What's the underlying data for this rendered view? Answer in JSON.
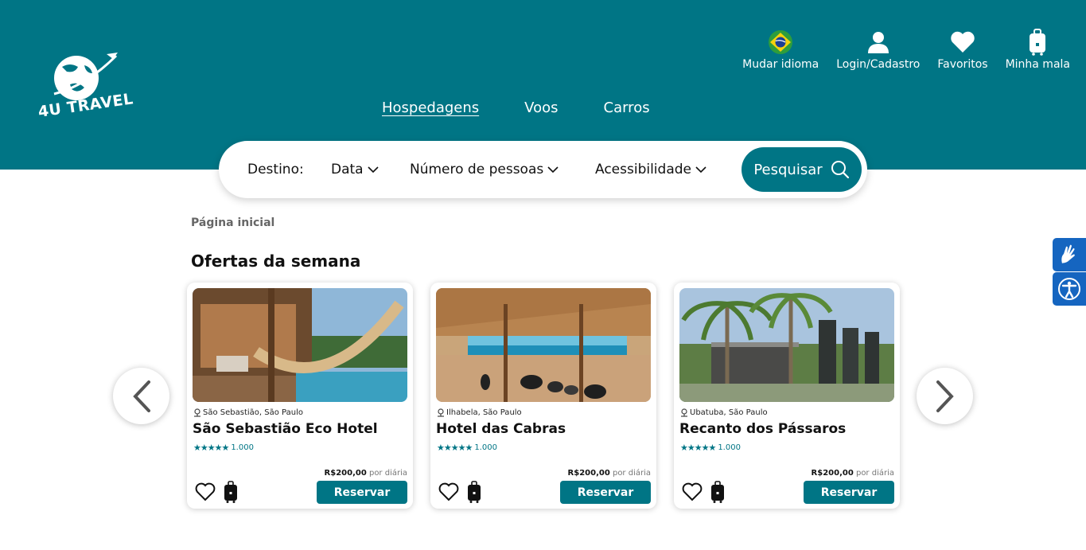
{
  "brand": {
    "name": "4U TRAVEL"
  },
  "top_actions": [
    {
      "label": "Mudar idioma",
      "icon": "brazil-flag-icon"
    },
    {
      "label": "Login/Cadastro",
      "icon": "user-icon"
    },
    {
      "label": "Favoritos",
      "icon": "heart-icon"
    },
    {
      "label": "Minha mala",
      "icon": "luggage-icon"
    }
  ],
  "nav": [
    {
      "label": "Hospedagens",
      "active": true
    },
    {
      "label": "Voos"
    },
    {
      "label": "Carros"
    }
  ],
  "search": {
    "destino": "Destino:",
    "data": "Data",
    "pessoas": "Número de pessoas",
    "acessibilidade": "Acessibilidade",
    "button": "Pesquisar"
  },
  "breadcrumb": "Página inicial",
  "section_title": "Ofertas da semana",
  "cards": [
    {
      "location": "São Sebastião, São Paulo",
      "name": "São Sebastião Eco Hotel",
      "stars": "★★★★★",
      "rating_count": "1.000",
      "price": "R$200,00",
      "per": "por diária",
      "button": "Reservar"
    },
    {
      "location": "Ilhabela, São Paulo",
      "name": "Hotel das Cabras",
      "stars": "★★★★★",
      "rating_count": "1.000",
      "price": "R$200,00",
      "per": "por diária",
      "button": "Reservar"
    },
    {
      "location": "Ubatuba, São Paulo",
      "name": "Recanto dos Pássaros",
      "stars": "★★★★★",
      "rating_count": "1.000",
      "price": "R$200,00",
      "per": "por diária",
      "button": "Reservar"
    }
  ],
  "colors": {
    "primary": "#007585",
    "accessibility": "#1565c0"
  }
}
